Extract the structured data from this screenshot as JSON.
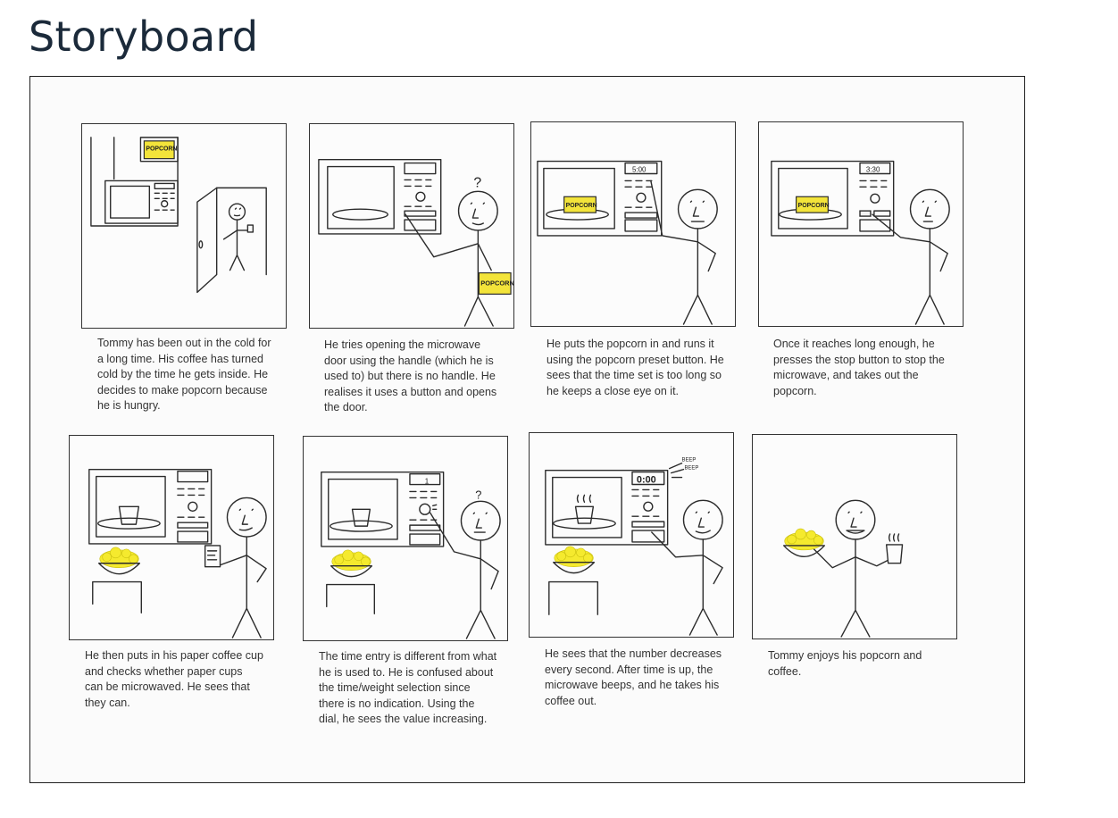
{
  "page": {
    "title": "Storyboard"
  },
  "labels": {
    "popcorn": "POPCORN",
    "time_5_00": "5:00",
    "time_3_30": "3:30",
    "time_1": "1",
    "time_0_00": "0:00",
    "beep": "BEEP",
    "question_mark": "?"
  },
  "panels": [
    {
      "caption": "Tommy has been out in the cold for a long time. His coffee has turned cold by the time he gets inside. He decides to make popcorn because he is hungry."
    },
    {
      "caption": "He tries opening the microwave door using the handle (which he is used to) but there is no handle. He realises it uses a button and opens the door."
    },
    {
      "caption": "He puts the popcorn in and runs it using the popcorn preset button. He sees that the time set is too long so he keeps a close eye on it."
    },
    {
      "caption": "Once it reaches long enough, he presses the stop button to stop the microwave, and takes out the popcorn."
    },
    {
      "caption": "He then puts in his paper coffee cup and checks whether paper cups can be microwaved. He sees that they can."
    },
    {
      "caption": "The time entry is different from what he is used to. He is confused about the time/weight selection since there is no indication. Using the dial, he sees the value increasing."
    },
    {
      "caption": "He sees that the number decreases every second. After time is up, the microwave beeps, and he takes his coffee out."
    },
    {
      "caption": "Tommy enjoys his popcorn and coffee."
    }
  ]
}
